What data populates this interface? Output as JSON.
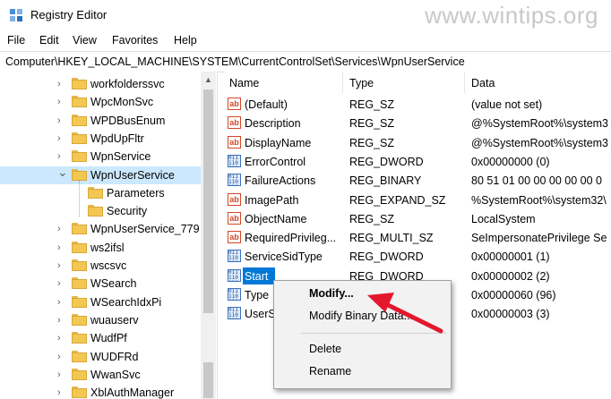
{
  "window": {
    "title": "Registry Editor",
    "watermark": "www.wintips.org"
  },
  "menu": [
    "File",
    "Edit",
    "View",
    "Favorites",
    "Help"
  ],
  "address": "Computer\\HKEY_LOCAL_MACHINE\\SYSTEM\\CurrentControlSet\\Services\\WpnUserService",
  "tree": {
    "items": [
      {
        "label": "workfolderssvc",
        "level": 0,
        "expanded": false
      },
      {
        "label": "WpcMonSvc",
        "level": 0,
        "expanded": false
      },
      {
        "label": "WPDBusEnum",
        "level": 0,
        "expanded": false
      },
      {
        "label": "WpdUpFltr",
        "level": 0,
        "expanded": false
      },
      {
        "label": "WpnService",
        "level": 0,
        "expanded": false
      },
      {
        "label": "WpnUserService",
        "level": 0,
        "expanded": true,
        "selected": true
      },
      {
        "label": "Parameters",
        "level": 1
      },
      {
        "label": "Security",
        "level": 1
      },
      {
        "label": "WpnUserService_779",
        "level": 0,
        "expanded": false
      },
      {
        "label": "ws2ifsl",
        "level": 0,
        "expanded": false
      },
      {
        "label": "wscsvc",
        "level": 0,
        "expanded": false
      },
      {
        "label": "WSearch",
        "level": 0,
        "expanded": false
      },
      {
        "label": "WSearchIdxPi",
        "level": 0,
        "expanded": false
      },
      {
        "label": "wuauserv",
        "level": 0,
        "expanded": false
      },
      {
        "label": "WudfPf",
        "level": 0,
        "expanded": false
      },
      {
        "label": "WUDFRd",
        "level": 0,
        "expanded": false
      },
      {
        "label": "WwanSvc",
        "level": 0,
        "expanded": false
      },
      {
        "label": "XblAuthManager",
        "level": 0,
        "expanded": false
      }
    ]
  },
  "values": {
    "columns": {
      "name": "Name",
      "type": "Type",
      "data": "Data"
    },
    "rows": [
      {
        "name": "(Default)",
        "type": "REG_SZ",
        "data": "(value not set)",
        "icon": "ab"
      },
      {
        "name": "Description",
        "type": "REG_SZ",
        "data": "@%SystemRoot%\\system3",
        "icon": "ab"
      },
      {
        "name": "DisplayName",
        "type": "REG_SZ",
        "data": "@%SystemRoot%\\system3",
        "icon": "ab"
      },
      {
        "name": "ErrorControl",
        "type": "REG_DWORD",
        "data": "0x00000000 (0)",
        "icon": "bin"
      },
      {
        "name": "FailureActions",
        "type": "REG_BINARY",
        "data": "80 51 01 00 00 00 00 00 0",
        "icon": "bin"
      },
      {
        "name": "ImagePath",
        "type": "REG_EXPAND_SZ",
        "data": "%SystemRoot%\\system32\\",
        "icon": "ab"
      },
      {
        "name": "ObjectName",
        "type": "REG_SZ",
        "data": "LocalSystem",
        "icon": "ab"
      },
      {
        "name": "RequiredPrivileg...",
        "type": "REG_MULTI_SZ",
        "data": "SeImpersonatePrivilege Se",
        "icon": "ab"
      },
      {
        "name": "ServiceSidType",
        "type": "REG_DWORD",
        "data": "0x00000001 (1)",
        "icon": "bin"
      },
      {
        "name": "Start",
        "type": "REG_DWORD",
        "data": "0x00000002 (2)",
        "icon": "bin",
        "selected": true
      },
      {
        "name": "Type",
        "type": "",
        "data": "0x00000060 (96)",
        "icon": "bin"
      },
      {
        "name": "UserS",
        "type": "",
        "data": "0x00000003 (3)",
        "icon": "bin"
      }
    ]
  },
  "context_menu": {
    "items": [
      {
        "label": "Modify...",
        "bold": true
      },
      {
        "label": "Modify Binary Data..."
      },
      {
        "separator": true
      },
      {
        "label": "Delete"
      },
      {
        "label": "Rename"
      }
    ]
  },
  "colors": {
    "selection": "#0078d7",
    "tree_selection": "#cce8ff",
    "arrow": "#e3182d"
  }
}
